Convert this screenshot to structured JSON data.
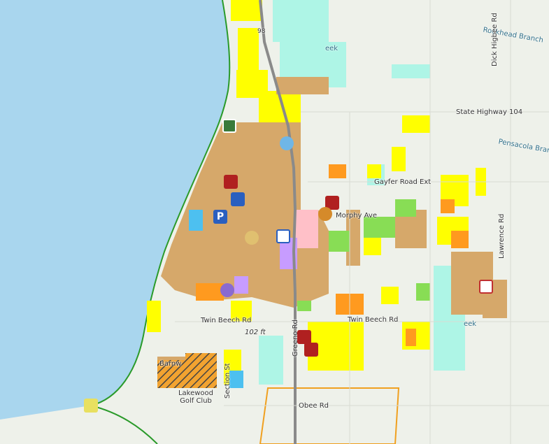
{
  "map": {
    "labels": {
      "rockhead_branch": "Rockhead Branch",
      "dick_higbee_rd": "Dick Higbee Rd",
      "state_highway_104": "State Highway 104",
      "pensacola_branch": "Pensacola Branch",
      "gayfer_road_ext": "Gayfer Road Ext",
      "morphy_ave": "Morphy Ave",
      "lawrence_rd": "Lawrence Rd",
      "twin_beech_rd_west": "Twin Beech Rd",
      "twin_beech_rd_east": "Twin Beech Rd",
      "spot_elevation": "102 ft",
      "greeno_rd": "Greeno Rd",
      "section_st": "Section St",
      "lakewood_golf_club": "Lakewood Golf Club",
      "obee_rd": "Obee Rd",
      "creek_fragment_north": "eek",
      "creek_fragment_east": "eek",
      "barnwell_fragment": "Barnw",
      "route_98": "98"
    },
    "colors": {
      "water": "#a9d6ee",
      "land": "#eef1ea",
      "residential_yellow": "#ffff00",
      "commercial_tan": "#d6a86a",
      "aqua_zone": "#aef5e6",
      "orange_zone": "#ff9a1f",
      "green_zone": "#88dd55",
      "purple_zone": "#c79cff",
      "pink_zone": "#ffc0c8",
      "city_limit": "#2a9a2a",
      "planning_outline": "#f0a020",
      "highway": "#8a8a8a"
    },
    "poi_icons": [
      "boat-ramp-icon",
      "school-icon",
      "parking-icon",
      "city-hall-icon",
      "library-icon",
      "fire-station-icon",
      "courthouse-icon",
      "park-icon",
      "hospital-icon",
      "beach-icon",
      "water-tower-icon"
    ]
  }
}
